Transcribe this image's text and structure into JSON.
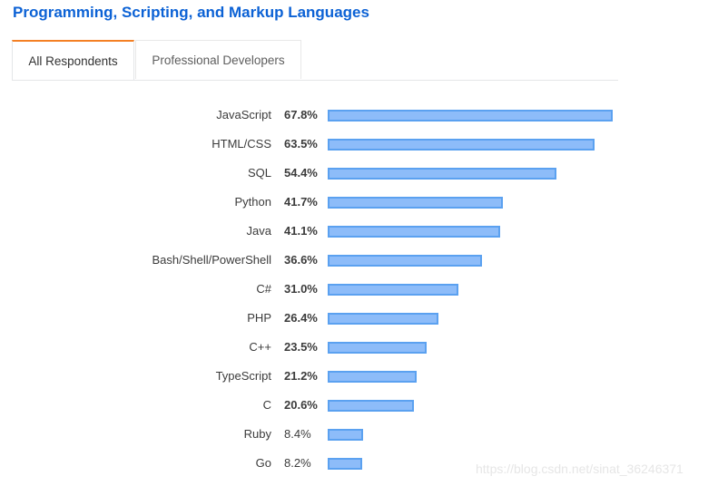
{
  "title": "Programming, Scripting, and Markup Languages",
  "tabs": [
    {
      "label": "All Respondents",
      "active": true
    },
    {
      "label": "Professional Developers",
      "active": false
    }
  ],
  "colors": {
    "title": "#0c62d5",
    "tab_active_accent": "#f48024",
    "bar_fill": "#8dbcf9",
    "bar_border": "#5ba1f0"
  },
  "chart_data": {
    "type": "bar",
    "orientation": "horizontal",
    "title": "Programming, Scripting, and Markup Languages",
    "xlabel": "",
    "ylabel": "",
    "unit": "%",
    "xlim": [
      0,
      67.8
    ],
    "grid": false,
    "categories": [
      "JavaScript",
      "HTML/CSS",
      "SQL",
      "Python",
      "Java",
      "Bash/Shell/PowerShell",
      "C#",
      "PHP",
      "C++",
      "TypeScript",
      "C",
      "Ruby",
      "Go"
    ],
    "values": [
      67.8,
      63.5,
      54.4,
      41.7,
      41.1,
      36.6,
      31.0,
      26.4,
      23.5,
      21.2,
      20.6,
      8.4,
      8.2
    ],
    "value_labels": [
      "67.8%",
      "63.5%",
      "54.4%",
      "41.7%",
      "41.1%",
      "36.6%",
      "31.0%",
      "26.4%",
      "23.5%",
      "21.2%",
      "20.6%",
      "8.4%",
      "8.2%"
    ]
  },
  "watermark": "https://blog.csdn.net/sinat_36246371"
}
